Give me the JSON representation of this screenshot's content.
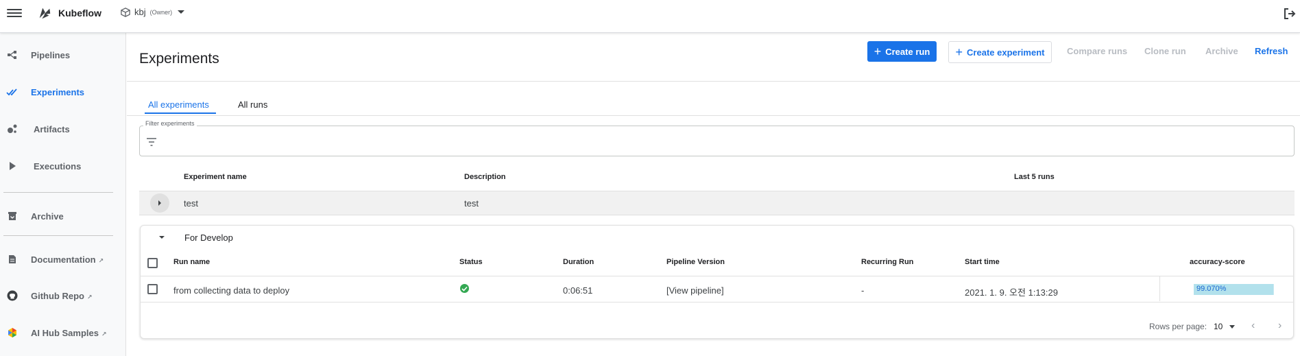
{
  "app": {
    "title": "Kubeflow"
  },
  "namespace": {
    "name": "kbj",
    "role": "(Owner)"
  },
  "sidebar": {
    "items": [
      {
        "label": "Pipelines",
        "icon": "pipelines-icon"
      },
      {
        "label": "Experiments",
        "icon": "experiments-icon",
        "active": true
      },
      {
        "label": "Artifacts",
        "icon": "artifacts-icon"
      },
      {
        "label": "Executions",
        "icon": "executions-icon"
      },
      {
        "label": "Archive",
        "icon": "archive-icon"
      },
      {
        "label": "Documentation",
        "icon": "documentation-icon",
        "external": true
      },
      {
        "label": "Github Repo",
        "icon": "github-icon",
        "external": true
      },
      {
        "label": "AI Hub Samples",
        "icon": "ai-hub-icon",
        "external": true
      }
    ]
  },
  "toolbar": {
    "page_title": "Experiments",
    "create_run": "Create run",
    "create_experiment": "Create experiment",
    "compare_runs": "Compare runs",
    "clone_run": "Clone run",
    "archive": "Archive",
    "refresh": "Refresh"
  },
  "tabs": {
    "all_experiments": "All experiments",
    "all_runs": "All runs"
  },
  "filter": {
    "label": "Filter experiments",
    "value": ""
  },
  "experiments_table": {
    "headers": {
      "name": "Experiment name",
      "description": "Description",
      "last_runs": "Last 5 runs"
    },
    "rows": [
      {
        "name": "test",
        "description": "test"
      }
    ]
  },
  "expanded_experiment": {
    "title": "For Develop",
    "run_headers": {
      "run_name": "Run name",
      "status": "Status",
      "duration": "Duration",
      "pipeline_version": "Pipeline Version",
      "recurring_run": "Recurring Run",
      "start_time": "Start time",
      "metric": "accuracy-score"
    },
    "runs": [
      {
        "run_name": "from collecting data to deploy",
        "status": "succeeded",
        "duration": "0:06:51",
        "pipeline_version": "[View pipeline]",
        "recurring_run": "-",
        "start_time": "2021. 1. 9. 오전 1:13:29",
        "metric_text": "99.070%",
        "metric_value": 0.9907
      }
    ],
    "pagination": {
      "rows_per_page_label": "Rows per page:",
      "rows_per_page": "10"
    }
  },
  "colors": {
    "accent": "#1a73e8",
    "success": "#34a853",
    "metric_bar": "#c8eaf2"
  }
}
